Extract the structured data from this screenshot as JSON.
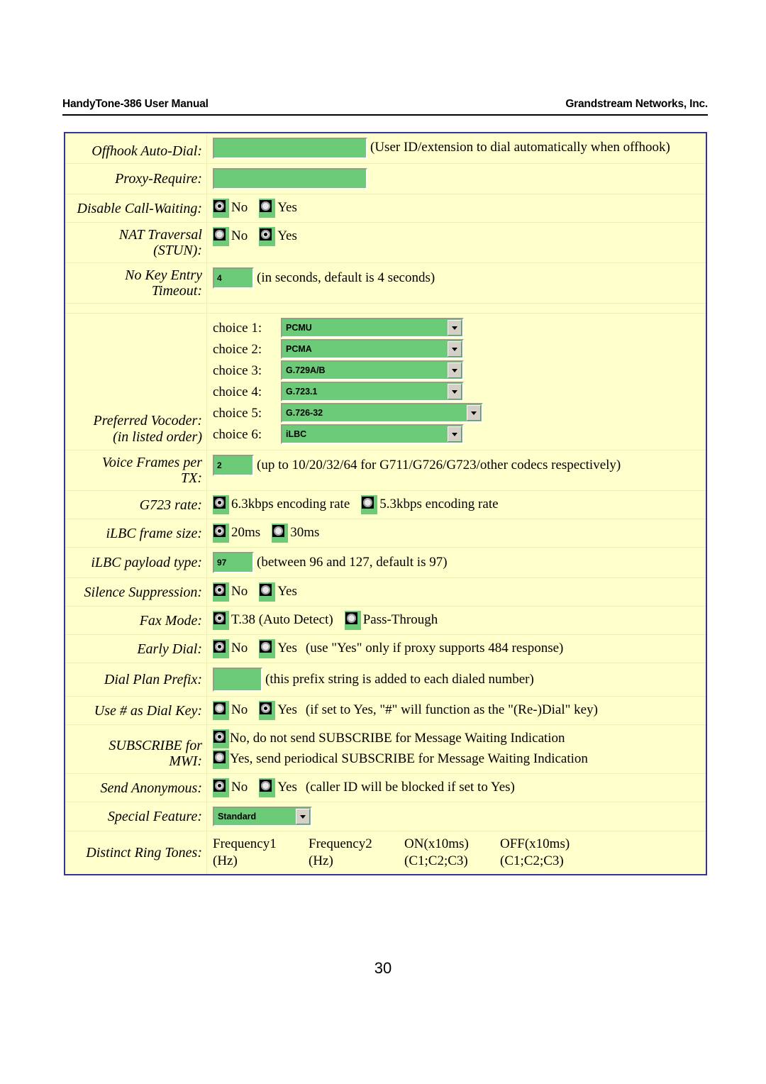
{
  "header": {
    "left": "HandyTone-386 User Manual",
    "right": "Grandstream Networks, Inc."
  },
  "page_number": "30",
  "settings": {
    "offhook_auto_dial": {
      "label": "Offhook Auto-Dial:",
      "value": "",
      "note": "(User ID/extension to dial automatically when offhook)"
    },
    "proxy_require": {
      "label": "Proxy-Require:",
      "value": ""
    },
    "disable_call_waiting": {
      "label": "Disable Call-Waiting:",
      "option_no": "No",
      "option_yes": "Yes",
      "selected": "No"
    },
    "nat_traversal": {
      "label": "NAT Traversal (STUN):",
      "label_line1": "NAT Traversal",
      "label_line2": "(STUN):",
      "option_no": "No",
      "option_yes": "Yes",
      "selected": "Yes"
    },
    "no_key_entry_timeout": {
      "label": "No Key Entry Timeout:",
      "label_line1": "No Key Entry",
      "label_line2": "Timeout:",
      "value": "4",
      "note": "(in seconds, default is 4 seconds)"
    },
    "preferred_vocoder": {
      "label_line1": "Preferred Vocoder:",
      "label_line2": "(in listed order)",
      "choices": [
        {
          "tag": "choice 1:",
          "value": "PCMU"
        },
        {
          "tag": "choice 2:",
          "value": "PCMA"
        },
        {
          "tag": "choice 3:",
          "value": "G.729A/B"
        },
        {
          "tag": "choice 4:",
          "value": "G.723.1"
        },
        {
          "tag": "choice 5:",
          "value": "G.726-32"
        },
        {
          "tag": "choice 6:",
          "value": "iLBC"
        }
      ]
    },
    "voice_frames_per_tx": {
      "label_line1": "Voice Frames per",
      "label_line2": "TX:",
      "value": "2",
      "note": "(up to 10/20/32/64 for G711/G726/G723/other codecs respectively)"
    },
    "g723_rate": {
      "label": "G723 rate:",
      "option_1": "6.3kbps encoding rate",
      "option_2": "5.3kbps encoding rate",
      "selected": "6.3kbps encoding rate"
    },
    "ilbc_frame_size": {
      "label": "iLBC frame size:",
      "option_1": "20ms",
      "option_2": "30ms",
      "selected": "20ms"
    },
    "ilbc_payload_type": {
      "label": "iLBC payload type:",
      "value": "97",
      "note": "(between 96 and 127, default is 97)"
    },
    "silence_suppression": {
      "label": "Silence Suppression:",
      "option_no": "No",
      "option_yes": "Yes",
      "selected": "No"
    },
    "fax_mode": {
      "label": "Fax Mode:",
      "option_1": "T.38 (Auto Detect)",
      "option_2": "Pass-Through",
      "selected": "T.38 (Auto Detect)"
    },
    "early_dial": {
      "label": "Early Dial:",
      "option_no": "No",
      "option_yes": "Yes",
      "selected": "No",
      "note": "(use \"Yes\" only if proxy supports 484 response)"
    },
    "dial_plan_prefix": {
      "label": "Dial Plan Prefix:",
      "value": "",
      "note": "(this prefix string is added to each dialed number)"
    },
    "use_hash_as_dial_key": {
      "label": "Use # as Dial Key:",
      "option_no": "No",
      "option_yes": "Yes",
      "selected": "Yes",
      "note": "(if set to Yes, \"#\" will function as the \"(Re-)Dial\" key)"
    },
    "subscribe_for_mwi": {
      "label_line1": "SUBSCRIBE for",
      "label_line2": "MWI:",
      "option_1": "No, do not send SUBSCRIBE for Message Waiting Indication",
      "option_2": "Yes, send periodical SUBSCRIBE for Message Waiting Indication",
      "selected": "No, do not send SUBSCRIBE for Message Waiting Indication"
    },
    "send_anonymous": {
      "label": "Send Anonymous:",
      "option_no": "No",
      "option_yes": "Yes",
      "selected": "No",
      "note": "(caller ID will be blocked if set to Yes)"
    },
    "special_feature": {
      "label": "Special Feature:",
      "value": "Standard"
    },
    "distinct_ring_tones": {
      "label": "Distinct Ring Tones:",
      "columns": [
        {
          "line1": "Frequency1",
          "line2": "(Hz)"
        },
        {
          "line1": "Frequency2",
          "line2": "(Hz)"
        },
        {
          "line1": "ON(x10ms)",
          "line2": "(C1;C2;C3)"
        },
        {
          "line1": "OFF(x10ms)",
          "line2": "(C1;C2;C3)"
        }
      ]
    }
  },
  "colors": {
    "field_green": "#6ccb78",
    "page_cream": "#ffffcc",
    "table_border": "#333399"
  }
}
